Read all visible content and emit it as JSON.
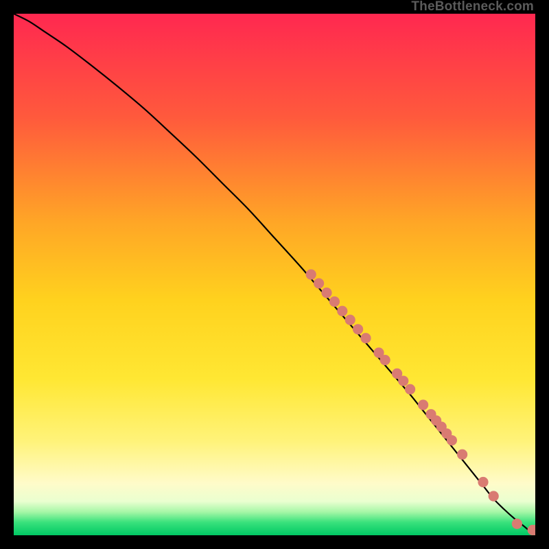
{
  "watermark": "TheBottleneck.com",
  "gradient": {
    "stops": [
      {
        "offset": 0.0,
        "color": "#ff2850"
      },
      {
        "offset": 0.2,
        "color": "#ff5a3c"
      },
      {
        "offset": 0.4,
        "color": "#ffa626"
      },
      {
        "offset": 0.55,
        "color": "#ffd21e"
      },
      {
        "offset": 0.7,
        "color": "#ffe733"
      },
      {
        "offset": 0.82,
        "color": "#fff37a"
      },
      {
        "offset": 0.9,
        "color": "#fffbc9"
      },
      {
        "offset": 0.935,
        "color": "#eaffd0"
      },
      {
        "offset": 0.955,
        "color": "#a7f7a7"
      },
      {
        "offset": 0.975,
        "color": "#3ae27c"
      },
      {
        "offset": 1.0,
        "color": "#00c864"
      }
    ]
  },
  "chart_data": {
    "type": "line",
    "title": "",
    "xlabel": "",
    "ylabel": "",
    "xlim": [
      0,
      100
    ],
    "ylim": [
      0,
      100
    ],
    "series": [
      {
        "name": "curve",
        "x": [
          0,
          3,
          6,
          10,
          15,
          20,
          25,
          30,
          35,
          40,
          45,
          50,
          55,
          58,
          61,
          64,
          67,
          70,
          73,
          76,
          78,
          80,
          82,
          84,
          86,
          88,
          90,
          92,
          94,
          96,
          98,
          99,
          100
        ],
        "y": [
          100,
          98.5,
          96.5,
          93.8,
          90,
          86,
          81.8,
          77.2,
          72.5,
          67.5,
          62.5,
          57,
          51.5,
          48,
          44.5,
          41,
          37.5,
          34,
          30.5,
          27,
          24.5,
          22,
          19.5,
          17,
          14.5,
          12,
          9.5,
          7,
          5,
          3.2,
          1.6,
          0.8,
          0.8
        ]
      }
    ],
    "markers": {
      "color": "#d97b72",
      "radius_frac": 0.01,
      "points": [
        {
          "x": 57.0,
          "y": 50.0
        },
        {
          "x": 58.5,
          "y": 48.3
        },
        {
          "x": 60.0,
          "y": 46.5
        },
        {
          "x": 61.5,
          "y": 44.8
        },
        {
          "x": 63.0,
          "y": 43.0
        },
        {
          "x": 64.5,
          "y": 41.3
        },
        {
          "x": 66.0,
          "y": 39.5
        },
        {
          "x": 67.5,
          "y": 37.8
        },
        {
          "x": 70.0,
          "y": 35.0
        },
        {
          "x": 71.2,
          "y": 33.6
        },
        {
          "x": 73.5,
          "y": 31.0
        },
        {
          "x": 74.7,
          "y": 29.6
        },
        {
          "x": 76.0,
          "y": 28.0
        },
        {
          "x": 78.5,
          "y": 25.0
        },
        {
          "x": 80.0,
          "y": 23.2
        },
        {
          "x": 81.0,
          "y": 22.0
        },
        {
          "x": 82.0,
          "y": 20.8
        },
        {
          "x": 83.0,
          "y": 19.5
        },
        {
          "x": 84.0,
          "y": 18.2
        },
        {
          "x": 86.0,
          "y": 15.5
        },
        {
          "x": 90.0,
          "y": 10.2
        },
        {
          "x": 92.0,
          "y": 7.5
        },
        {
          "x": 96.5,
          "y": 2.2
        },
        {
          "x": 99.5,
          "y": 1.0
        },
        {
          "x": 100.0,
          "y": 1.0
        }
      ]
    }
  }
}
